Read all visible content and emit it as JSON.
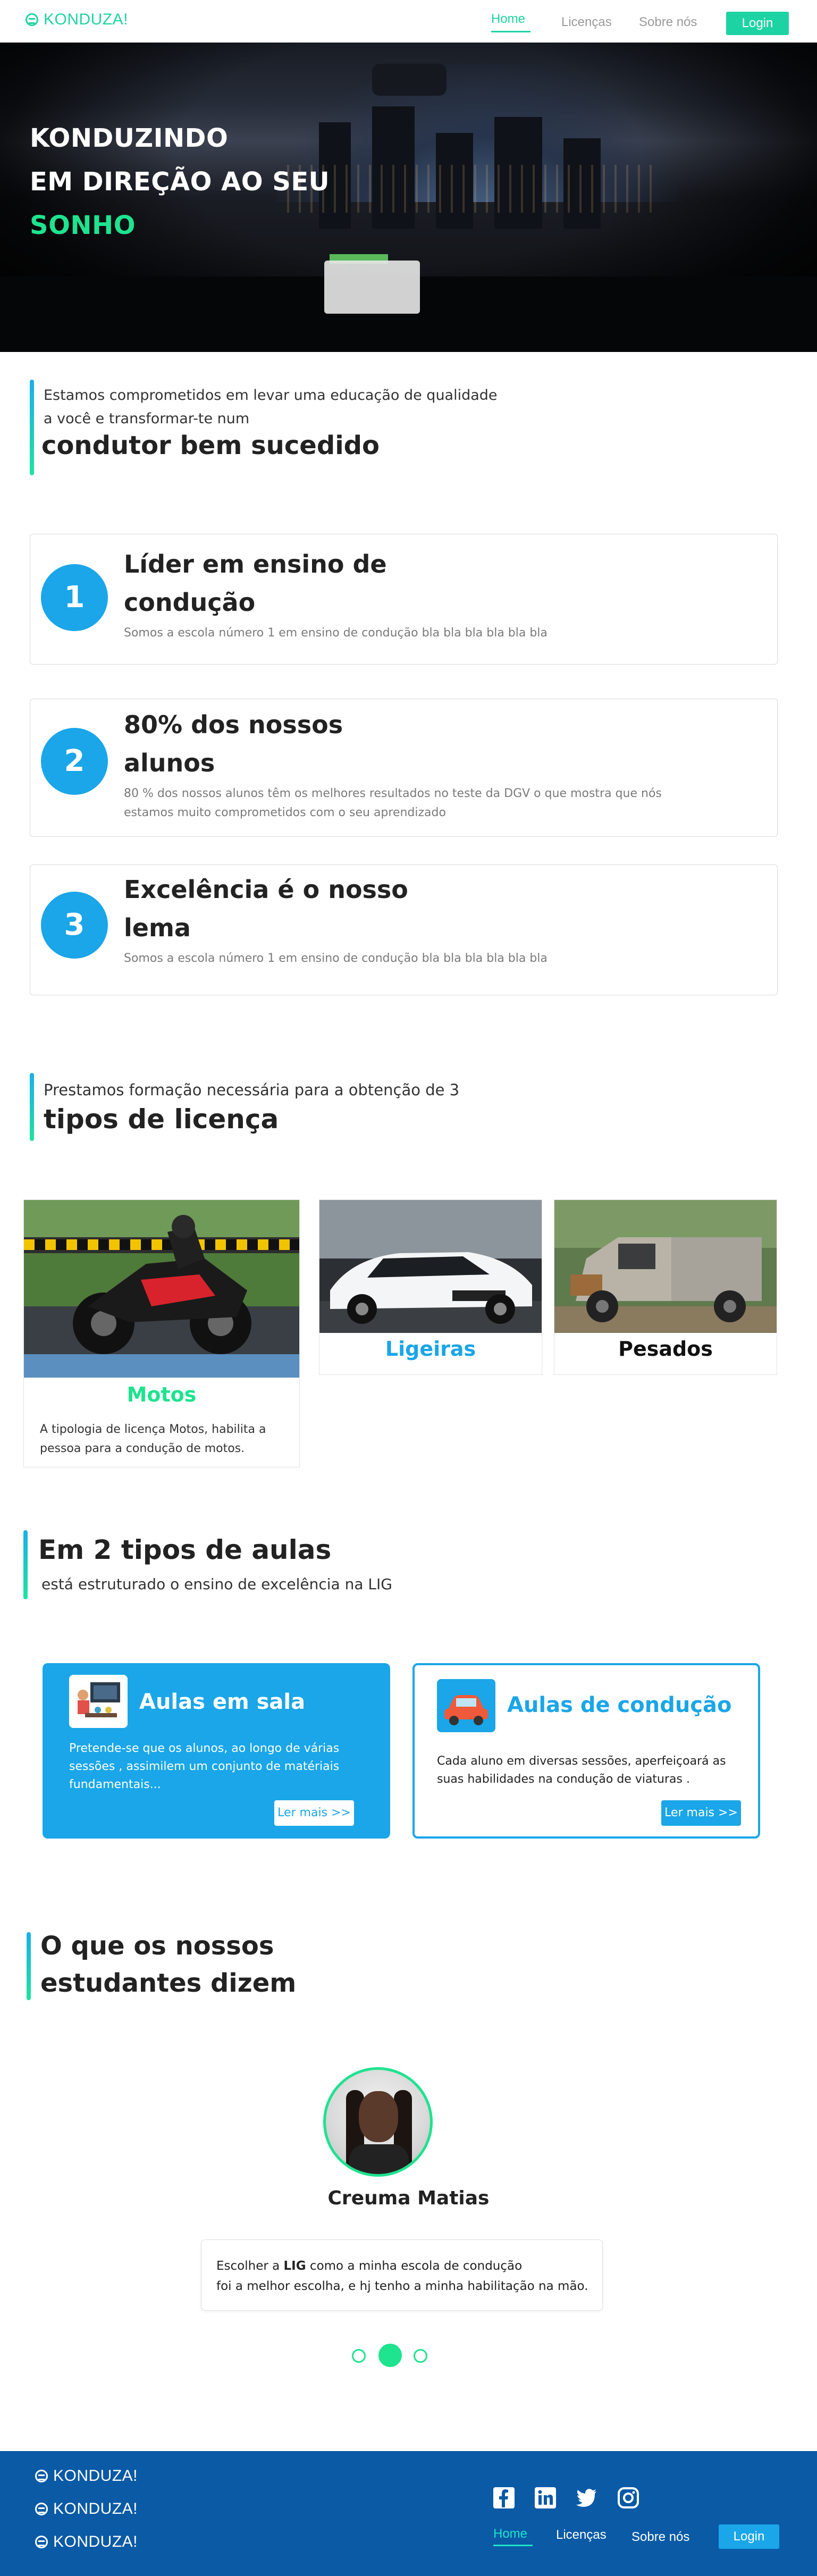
{
  "header": {
    "logo_text": "KONDUZA!",
    "nav": [
      {
        "label": "Home",
        "active": true
      },
      {
        "label": "Licenças",
        "active": false
      },
      {
        "label": "Sobre nós",
        "active": false
      }
    ],
    "login_label": "Login"
  },
  "hero": {
    "line1": "KONDUZINDO",
    "line2": "EM DIREÇÃO AO SEU",
    "line3": "SONHO"
  },
  "intro": {
    "line1": "Estamos comprometidos em levar uma educação de qualidade",
    "line2": "a você e transformar-te num",
    "headline": "condutor bem sucedido"
  },
  "features": [
    {
      "number": "1",
      "title_line1": "Líder em ensino de",
      "title_line2": "condução",
      "text_line1": "Somos a escola número 1 em ensino de condução bla bla bla bla bla bla",
      "text_line2": ""
    },
    {
      "number": "2",
      "title_line1": "80% dos nossos",
      "title_line2": "alunos",
      "text_line1": "80 % dos nossos alunos têm os melhores resultados no teste da DGV o que mostra que nós",
      "text_line2": "estamos muito comprometidos com o seu aprendizado"
    },
    {
      "number": "3",
      "title_line1": "Excelência é o nosso",
      "title_line2": "lema",
      "text_line1": "Somos a escola número 1 em ensino de condução bla bla bla bla bla bla",
      "text_line2": ""
    }
  ],
  "licenses_section": {
    "intro": "Prestamos formação necessária para a obtenção de 3",
    "headline": "tipos de licença"
  },
  "licenses": [
    {
      "title": "Motos",
      "title_color": "#1ee38f",
      "desc_line1": "A tipologia de licença Motos, habilita a",
      "desc_line2": "pessoa para  a condução de motos."
    },
    {
      "title": "Ligeiras",
      "title_color": "#1aa6e8"
    },
    {
      "title": "Pesados",
      "title_color": "#111111"
    }
  ],
  "classes_section": {
    "headline": "Em 2 tipos de aulas",
    "sub": "está estruturado o ensino de excelência  na LIG"
  },
  "classes": [
    {
      "title": "Aulas em sala",
      "text_line1": "Pretende-se que os alunos, ao longo de várias",
      "text_line2": "sessões , assimilem um conjunto de matériais",
      "text_line3": "fundamentais...",
      "button": "Ler mais >>",
      "icon": "classroom-icon"
    },
    {
      "title": "Aulas de condução",
      "text_line1": "Cada aluno em diversas sessões, aperfeiçoará as",
      "text_line2": "suas habilidades na condução de viaturas .",
      "button": "Ler mais >>",
      "icon": "car-icon"
    }
  ],
  "testimonials_section": {
    "line1": "O que os nossos",
    "line2": "estudantes dizem"
  },
  "testimonial": {
    "name": "Creuma Matias",
    "quote_pre": "Escolher a ",
    "quote_bold": "LIG",
    "quote_post": " como a minha escola de condução",
    "quote_line2": "foi a melhor escolha, e hj tenho a minha habilitação na mão.",
    "active_dot": 2,
    "dot_count": 3
  },
  "footer": {
    "logo_text": "KONDUZA!",
    "social": [
      "facebook-icon",
      "linkedin-icon",
      "twitter-icon",
      "instagram-icon"
    ],
    "nav": [
      {
        "label": "Home",
        "active": true
      },
      {
        "label": "Licenças",
        "active": false
      },
      {
        "label": "Sobre nós",
        "active": false
      }
    ],
    "login_label": "Login"
  },
  "colors": {
    "accent_green": "#1ed3a3",
    "accent_blue": "#1aa6e8",
    "footer_blue": "#0a5aa6",
    "hero_green": "#1ee38f"
  }
}
